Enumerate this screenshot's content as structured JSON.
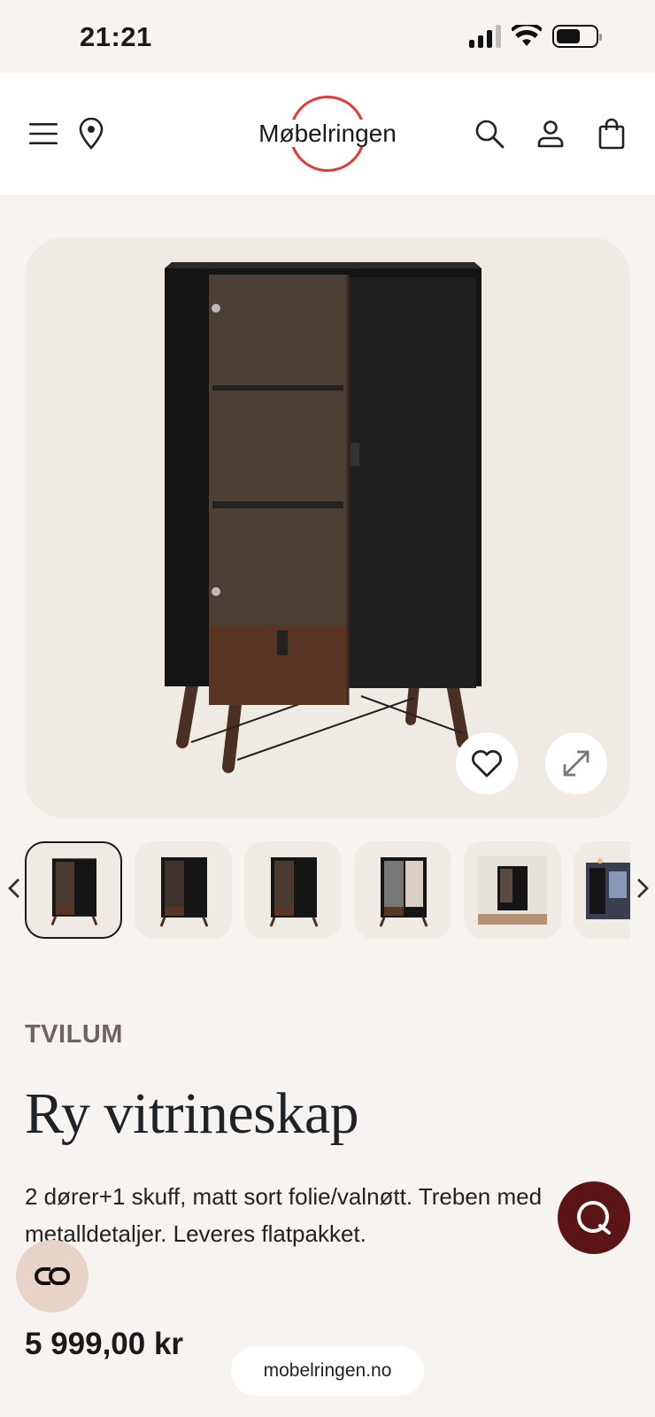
{
  "status": {
    "time": "21:21"
  },
  "header": {
    "logo_text": "Møbelringen"
  },
  "product": {
    "brand": "TVILUM",
    "title": "Ry vitrineskap",
    "description": "2 dører+1 skuff, matt sort folie/valnøtt. Treben med metalldetaljer. Leveres flatpakket.",
    "price": "5 999,00 kr"
  },
  "thumbnails": {
    "count_visible": 6,
    "active_index": 0
  },
  "browser": {
    "url": "mobelringen.no"
  },
  "colors": {
    "background": "#f7f3f0",
    "accent_red": "#e53935",
    "chat_button": "#5c1515",
    "brand_text": "#6e6360",
    "card_bg": "#efeae3"
  },
  "icons": [
    "menu-icon",
    "location-pin-icon",
    "search-icon",
    "user-icon",
    "bag-icon",
    "heart-icon",
    "expand-icon",
    "chevron-left-icon",
    "chevron-right-icon",
    "chat-icon",
    "co-icon"
  ]
}
